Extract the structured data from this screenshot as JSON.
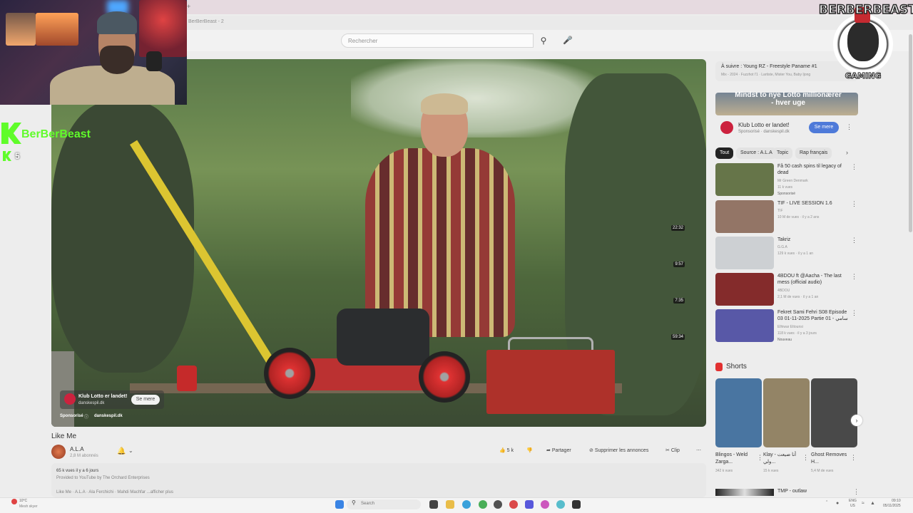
{
  "browser": {
    "tab_hint": "BerBerBeast - 2",
    "close_glyph": "+"
  },
  "header": {
    "search_placeholder": "Rechercher",
    "search_icon": "search-icon",
    "mic_icon": "mic-icon"
  },
  "stream_overlay": {
    "kick_name": "BerBerBeast",
    "kick_count": "5",
    "logo_top": "BERBERBEAST",
    "logo_bottom": "GAMING"
  },
  "video_ad": {
    "title": "Klub Lotto er landet!",
    "domain": "danskespil.dk",
    "cta": "Se mere",
    "sponsored": "Sponsorisé",
    "info_icon": "ⓘ",
    "site": "danskespil.dk"
  },
  "video": {
    "title": "Like Me",
    "channel": "A.L.A",
    "subscribers": "2,8 M abonnés",
    "actions": {
      "likes": "5 k",
      "share": "Partager",
      "remove_ads": "Supprimer les annonces",
      "clip": "Clip"
    },
    "description": {
      "stats": "65 k vues  il y a 6 jours",
      "provided": "Provided to YouTube by The Orchard Enterprises",
      "credits": "Like Me · A.L.A · Ala Ferchichi · Mahdi Machfar  ...afficher plus"
    }
  },
  "sidebar": {
    "next_up": {
      "title": "À suivre : Young RZ - Freestyle Paname #1",
      "sub": "Mix - 2024 · Fuzzhot l'1 · Lartiste, Mister You, Baby Ijong"
    },
    "ad": {
      "banner": "Mindst to nye Lotto millionærer - hver uge",
      "title": "Klub Lotto er landet!",
      "sub": "Sponsorisé · danskespil.dk",
      "cta": "Se mere"
    },
    "chips": [
      "Tout",
      "Source : A.L.A",
      "Topic",
      "Rap français"
    ],
    "recs": [
      {
        "title": "Få 50 cash spins til legacy of dead",
        "meta1": "Mr Green Denmark",
        "meta2": "11 k vues",
        "meta3": "Sponsorisé",
        "duration": "",
        "thumb": "#5a6a3a"
      },
      {
        "title": "TIF - LIVE SESSION 1.6",
        "meta1": "TIF",
        "meta2": "10 M de vues · il y a 2 ans",
        "meta3": "",
        "duration": "22:32",
        "thumb": "#8a6a5a"
      },
      {
        "title": "Takriz",
        "meta1": "G.G.A",
        "meta2": "129 k vues · il y a 1 an",
        "meta3": "",
        "duration": "9:57",
        "thumb": "#c9cdd0"
      },
      {
        "title": "4BDOU ft @Aacha - The last mess (official audio)",
        "meta1": "4BDOU",
        "meta2": "2,1 M de vues · il y a 1 an",
        "meta3": "",
        "duration": "7:35",
        "thumb": "#7a1a1a"
      },
      {
        "title": "Fekret Sami Fehri S08 Episode 03 01-11-2025 Partie 01 - سامي",
        "meta1": "Elhiwar Ettounsi",
        "meta2": "118 k vues · il y a 3 jours",
        "meta3": "Nouveau",
        "duration": "59:34",
        "thumb": "#4a4aa0"
      }
    ],
    "shorts_label": "Shorts",
    "shorts": [
      {
        "title": "Blingos - Weld Zarga...",
        "views": "342 k vues",
        "thumb": "#3a6a9a"
      },
      {
        "title": "Klay - أنا ضيعت ولي...",
        "views": "15 k vues",
        "thumb": "#8a7a5a"
      },
      {
        "title": "Ghost Removes H...",
        "views": "5,4 M de vues",
        "thumb": "#3a3a3a"
      }
    ],
    "tmp_title": "TMP - outlaw"
  },
  "taskbar": {
    "weather_temp": "10°C",
    "weather_desc": "Mesh skyer",
    "search": "Search",
    "lang_top": "ENG",
    "lang_bottom": "US",
    "time": "09:10",
    "date": "05/11/2025"
  }
}
